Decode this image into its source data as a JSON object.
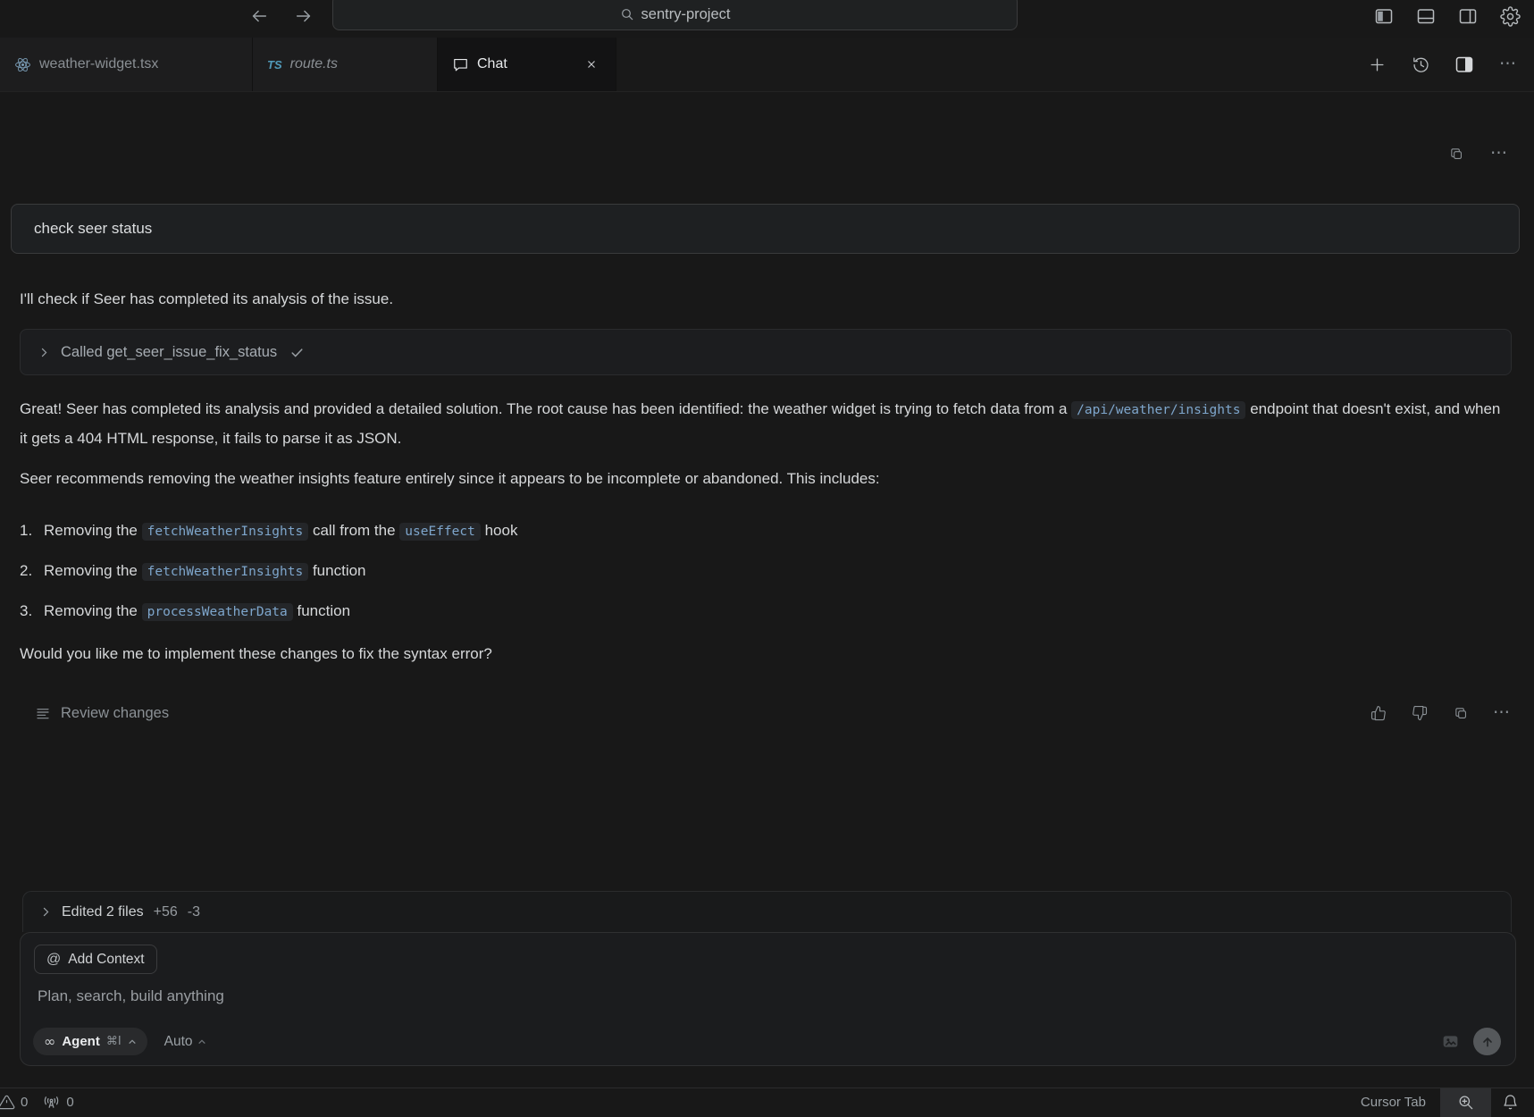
{
  "icons": {
    "infinity": "∞",
    "at": "@",
    "ellipsis": "⋯"
  },
  "titlebar": {
    "search_value": "sentry-project"
  },
  "tabbar": {
    "tabs": [
      {
        "label": "weather-widget.tsx"
      },
      {
        "prefix": "TS",
        "label": "route.ts"
      },
      {
        "label": "Chat"
      }
    ]
  },
  "chat": {
    "user_message": "check seer status",
    "intro": "I'll check if Seer has completed its analysis of the issue.",
    "tool_call_label": "Called get_seer_issue_fix_status",
    "paragraph1": [
      {
        "t": "text",
        "v": "Great! Seer has completed its analysis and provided a detailed solution. The root cause has been identified: the weather widget is trying to fetch data from a "
      },
      {
        "t": "code",
        "v": "/api/weather/insights"
      },
      {
        "t": "text",
        "v": " endpoint that doesn't exist, and when it gets a 404 HTML response, it fails to parse it as JSON."
      }
    ],
    "paragraph2": "Seer recommends removing the weather insights feature entirely since it appears to be incomplete or abandoned. This includes:",
    "list": [
      {
        "num": "1.",
        "segments": [
          {
            "t": "text",
            "v": "Removing the "
          },
          {
            "t": "code",
            "v": "fetchWeatherInsights"
          },
          {
            "t": "text",
            "v": " call from the "
          },
          {
            "t": "code",
            "v": "useEffect"
          },
          {
            "t": "text",
            "v": " hook"
          }
        ]
      },
      {
        "num": "2.",
        "segments": [
          {
            "t": "text",
            "v": "Removing the "
          },
          {
            "t": "code",
            "v": "fetchWeatherInsights"
          },
          {
            "t": "text",
            "v": " function"
          }
        ]
      },
      {
        "num": "3.",
        "segments": [
          {
            "t": "text",
            "v": "Removing the "
          },
          {
            "t": "code",
            "v": "processWeatherData"
          },
          {
            "t": "text",
            "v": " function"
          }
        ]
      }
    ],
    "question": "Would you like me to implement these changes to fix the syntax error?",
    "review_label": "Review changes",
    "edited": {
      "label": "Edited 2 files",
      "additions": "+56",
      "deletions": "-3"
    }
  },
  "composer": {
    "add_context_label": "Add Context",
    "placeholder": "Plan, search, build anything",
    "agent_label": "Agent",
    "agent_shortcut": "⌘I",
    "mode_label": "Auto"
  },
  "statusbar": {
    "problems_count": "0",
    "ports_count": "0",
    "cursor_tab_label": "Cursor Tab"
  },
  "colors": {
    "code_blue": "#7ea6cc",
    "active_text": "#e8eaec",
    "panel_bg": "#181818"
  }
}
